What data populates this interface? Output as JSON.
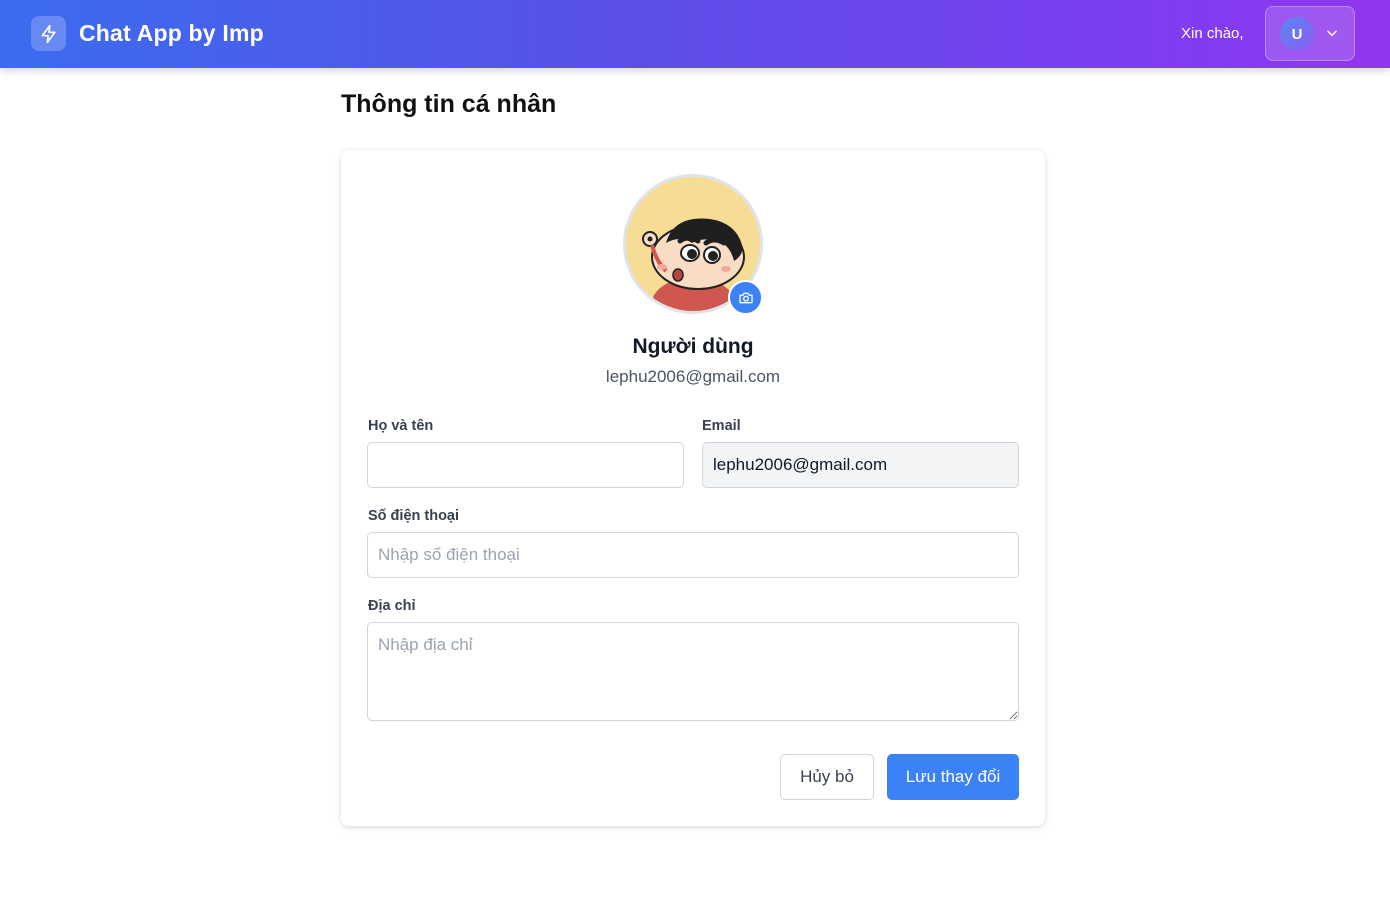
{
  "header": {
    "app_title": "Chat App by Imp",
    "logo_icon": "lightning-icon",
    "greeting": "Xin chào,",
    "user_initial": "U",
    "dropdown_icon": "chevron-down-icon"
  },
  "page": {
    "title": "Thông tin cá nhân"
  },
  "profile": {
    "display_name": "Người dùng",
    "email": "lephu2006@gmail.com",
    "avatar_icon": "cartoon-avatar-icon",
    "upload_icon": "camera-icon"
  },
  "form": {
    "full_name": {
      "label": "Họ và tên",
      "value": "",
      "placeholder": ""
    },
    "email": {
      "label": "Email",
      "value": "lephu2006@gmail.com"
    },
    "phone": {
      "label": "Số điện thoại",
      "value": "",
      "placeholder": "Nhập số điện thoại"
    },
    "address": {
      "label": "Địa chỉ",
      "value": "",
      "placeholder": "Nhập địa chỉ"
    }
  },
  "actions": {
    "cancel_label": "Hủy bỏ",
    "save_label": "Lưu thay đổi"
  },
  "colors": {
    "header_gradient_start": "#3b6cf0",
    "header_gradient_end": "#9136ee",
    "primary": "#3b82f6",
    "readonly_bg": "#f3f4f6"
  }
}
